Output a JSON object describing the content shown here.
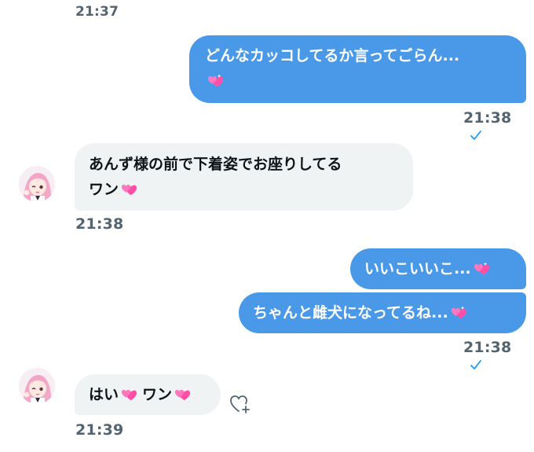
{
  "colors": {
    "outgoing_bubble": "#4a99e9",
    "incoming_bubble": "#eff3f4",
    "timestamp": "#536471",
    "heart": "#ff4fa6"
  },
  "messages": [
    {
      "time": "21:37"
    },
    {
      "direction": "outgoing",
      "lines": [
        "どんなカッコしてるか言ってごらん...",
        ""
      ],
      "emoji": "sparkling-heart",
      "time": "21:38",
      "status": "sent-check"
    },
    {
      "direction": "incoming",
      "lines": [
        "あんず様の前で下着姿でお座りしてる",
        "ワン"
      ],
      "emoji": "sparkling-heart",
      "time": "21:38"
    },
    {
      "direction": "outgoing",
      "lines": [
        "いいこいいこ..."
      ],
      "emoji": "sparkling-heart"
    },
    {
      "direction": "outgoing",
      "lines": [
        "ちゃんと雌犬になってるね..."
      ],
      "emoji": "sparkling-heart",
      "time": "21:38",
      "status": "sent-check"
    },
    {
      "direction": "incoming",
      "parts": [
        "はい",
        "ワン"
      ],
      "emoji": "sparkling-heart",
      "time": "21:39",
      "reaction_icon": "heart-plus-icon"
    }
  ]
}
